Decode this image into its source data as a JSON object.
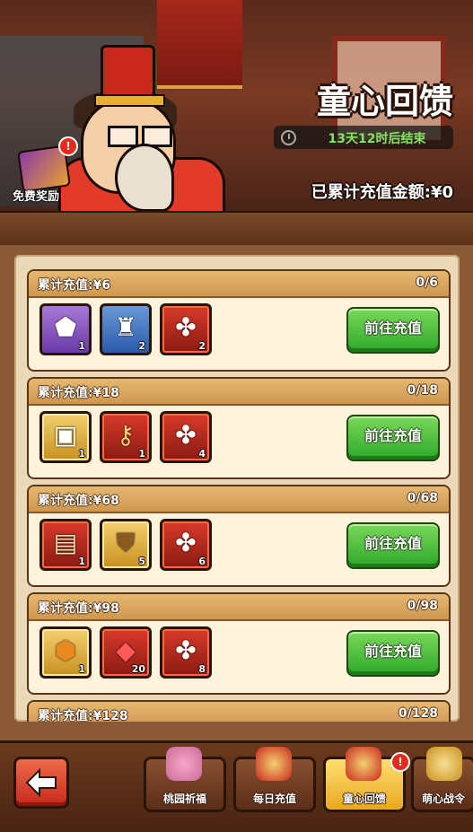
{
  "header": {
    "title": "童心回馈",
    "timer": "13天12时后结束",
    "total_recharge": "已累计充值金额:¥0",
    "free_reward_label": "免费奖励",
    "badge": "!"
  },
  "tiers": [
    {
      "requirement": "累计充值:¥6",
      "progress": "0/6",
      "button": "前往充值",
      "rewards": [
        {
          "icon": "purple-gem-chest-icon",
          "count": "1"
        },
        {
          "icon": "blue-crown-icon",
          "count": "2"
        },
        {
          "icon": "pinwheel-icon",
          "count": "2"
        }
      ]
    },
    {
      "requirement": "累计充值:¥18",
      "progress": "0/18",
      "button": "前往充值",
      "rewards": [
        {
          "icon": "treasure-chest-icon",
          "count": "1"
        },
        {
          "icon": "golden-key-icon",
          "count": "1"
        },
        {
          "icon": "pinwheel-icon",
          "count": "4"
        }
      ]
    },
    {
      "requirement": "累计充值:¥68",
      "progress": "0/68",
      "button": "前往充值",
      "rewards": [
        {
          "icon": "scroll-icon",
          "count": "1"
        },
        {
          "icon": "bronze-shield-icon",
          "count": "5"
        },
        {
          "icon": "pinwheel-icon",
          "count": "6"
        }
      ]
    },
    {
      "requirement": "累计充值:¥98",
      "progress": "0/98",
      "button": "前往充值",
      "rewards": [
        {
          "icon": "orange-gem-chest-icon",
          "count": "1"
        },
        {
          "icon": "red-ruby-icon",
          "count": "20"
        },
        {
          "icon": "pinwheel-icon",
          "count": "8"
        }
      ]
    },
    {
      "requirement": "累计充值:¥128",
      "progress": "0/128"
    }
  ],
  "nav": {
    "items": [
      {
        "label": "桃园祈福"
      },
      {
        "label": "每日充值"
      },
      {
        "label": "童心回馈"
      },
      {
        "label": "萌心战令"
      }
    ],
    "badge": "!"
  }
}
